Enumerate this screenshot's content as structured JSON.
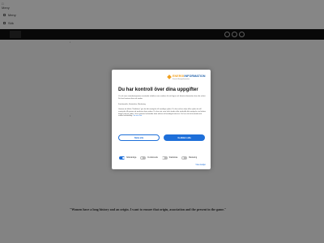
{
  "background": {
    "top_lines": [
      "□",
      "Meny"
    ],
    "nav": [
      {
        "label": "Meny"
      },
      {
        "label": "Sök"
      }
    ],
    "quote": "\"Women have a long history and an origin. I want to ensure that origin, association and the present in the game.\""
  },
  "modal": {
    "brand": {
      "name_prefix": "ENERGI",
      "name_suffix": "INFORMATION",
      "tagline": "Svenskt Energiinformation"
    },
    "title": "Du har kontroll över dina uppgifter",
    "intro": "Vi och våra samarbetspartner använder tekniker som cookies för att lagra och hämta information från din enhet. Du kan hantera dina val nedan.",
    "purposes": "Funktionella, Statistiska, Marketing",
    "body": "Genom att klicka \"Godkänn\" ger du ditt samtycke till samtliga syften. Du kan också välja vilka syften du vill samtycka till genom att markera dem nedan. Du kan när som helst ändra eller återkalla ditt samtycke via länken längst ned på sidan. Vissa partner behandlar data utifrån ett berättigat intresse. Du har rätt att invända mot sådan behandling.",
    "details_inline": "Se mer här",
    "buttons": {
      "reject": "Neka alla",
      "accept": "Godkänn alla"
    },
    "toggles": [
      {
        "label": "Nödvändiga",
        "on": true
      },
      {
        "label": "Funktionella",
        "on": false
      },
      {
        "label": "Statistiska",
        "on": false
      },
      {
        "label": "Marketing",
        "on": false
      }
    ],
    "details_link": "Visa detaljer"
  },
  "colors": {
    "accent": "#1e6fd9",
    "brand_orange": "#f0a020",
    "header_bar": "#101010"
  }
}
